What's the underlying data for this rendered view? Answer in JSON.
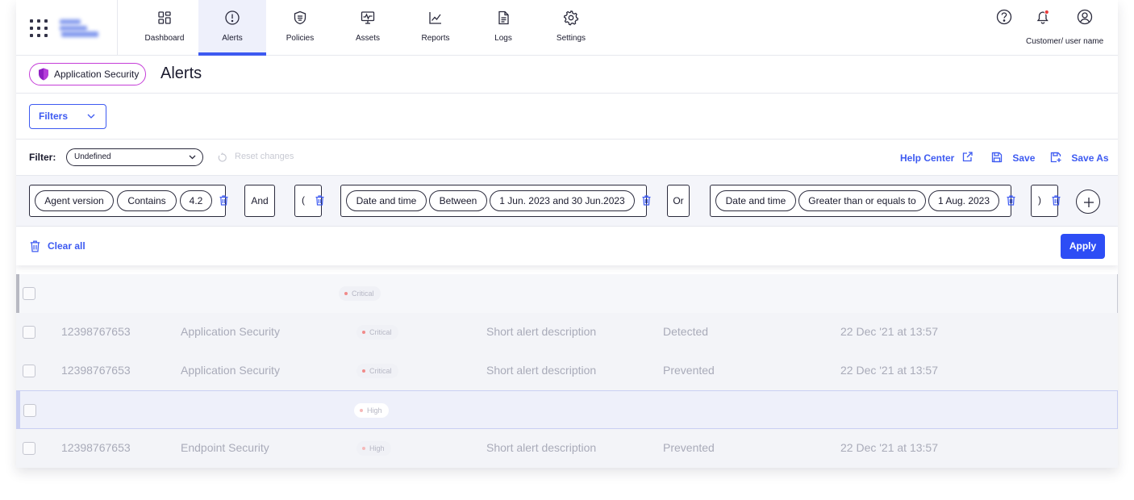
{
  "nav": {
    "items": [
      {
        "label": "Dashboard",
        "icon": "dashboard-icon"
      },
      {
        "label": "Alerts",
        "icon": "alert-circle-icon",
        "active": true
      },
      {
        "label": "Policies",
        "icon": "shield-list-icon"
      },
      {
        "label": "Assets",
        "icon": "monitor-search-icon"
      },
      {
        "label": "Reports",
        "icon": "chart-line-icon"
      },
      {
        "label": "Logs",
        "icon": "document-icon"
      },
      {
        "label": "Settings",
        "icon": "gear-icon"
      }
    ],
    "user_name": "Customer/ user name"
  },
  "header": {
    "product_badge": "Application Security",
    "title": "Alerts"
  },
  "filters_button": "Filters",
  "filter_row": {
    "label": "Filter:",
    "selected": "Undefined",
    "reset": "Reset changes",
    "help": "Help Center",
    "save": "Save",
    "save_as": "Save As"
  },
  "builder": {
    "group1": [
      "Agent version",
      "Contains",
      "4.2"
    ],
    "op1": "And",
    "open_paren": "(",
    "group2": [
      "Date and time",
      "Between",
      "1 Jun. 2023 and 30 Jun.2023"
    ],
    "op2": "Or",
    "group3": [
      "Date and time",
      "Greater than or equals to",
      "1 Aug. 2023"
    ],
    "close_paren": ")"
  },
  "actions": {
    "clear_all": "Clear all",
    "apply": "Apply"
  },
  "table": {
    "rows": [
      {
        "id": "",
        "product": "",
        "severity": "Critical",
        "description": "",
        "status": "",
        "time": ""
      },
      {
        "id": "12398767653",
        "product": "Application Security",
        "severity": "Critical",
        "description": "Short alert description",
        "status": "Detected",
        "time": "22 Dec '21 at 13:57"
      },
      {
        "id": "12398767653",
        "product": "Application Security",
        "severity": "Critical",
        "description": "Short alert description",
        "status": "Prevented",
        "time": "22 Dec '21 at 13:57"
      },
      {
        "id": "",
        "product": "",
        "severity": "High",
        "description": "",
        "status": "",
        "time": ""
      },
      {
        "id": "12398767653",
        "product": "Endpoint Security",
        "severity": "High",
        "description": "Short alert description",
        "status": "Prevented",
        "time": "22 Dec '21 at 13:57"
      }
    ]
  },
  "colors": {
    "accent": "#3d5af1",
    "badge_border": "#c53dd8",
    "critical": "#f08a8a",
    "high": "#f5b9b9"
  }
}
